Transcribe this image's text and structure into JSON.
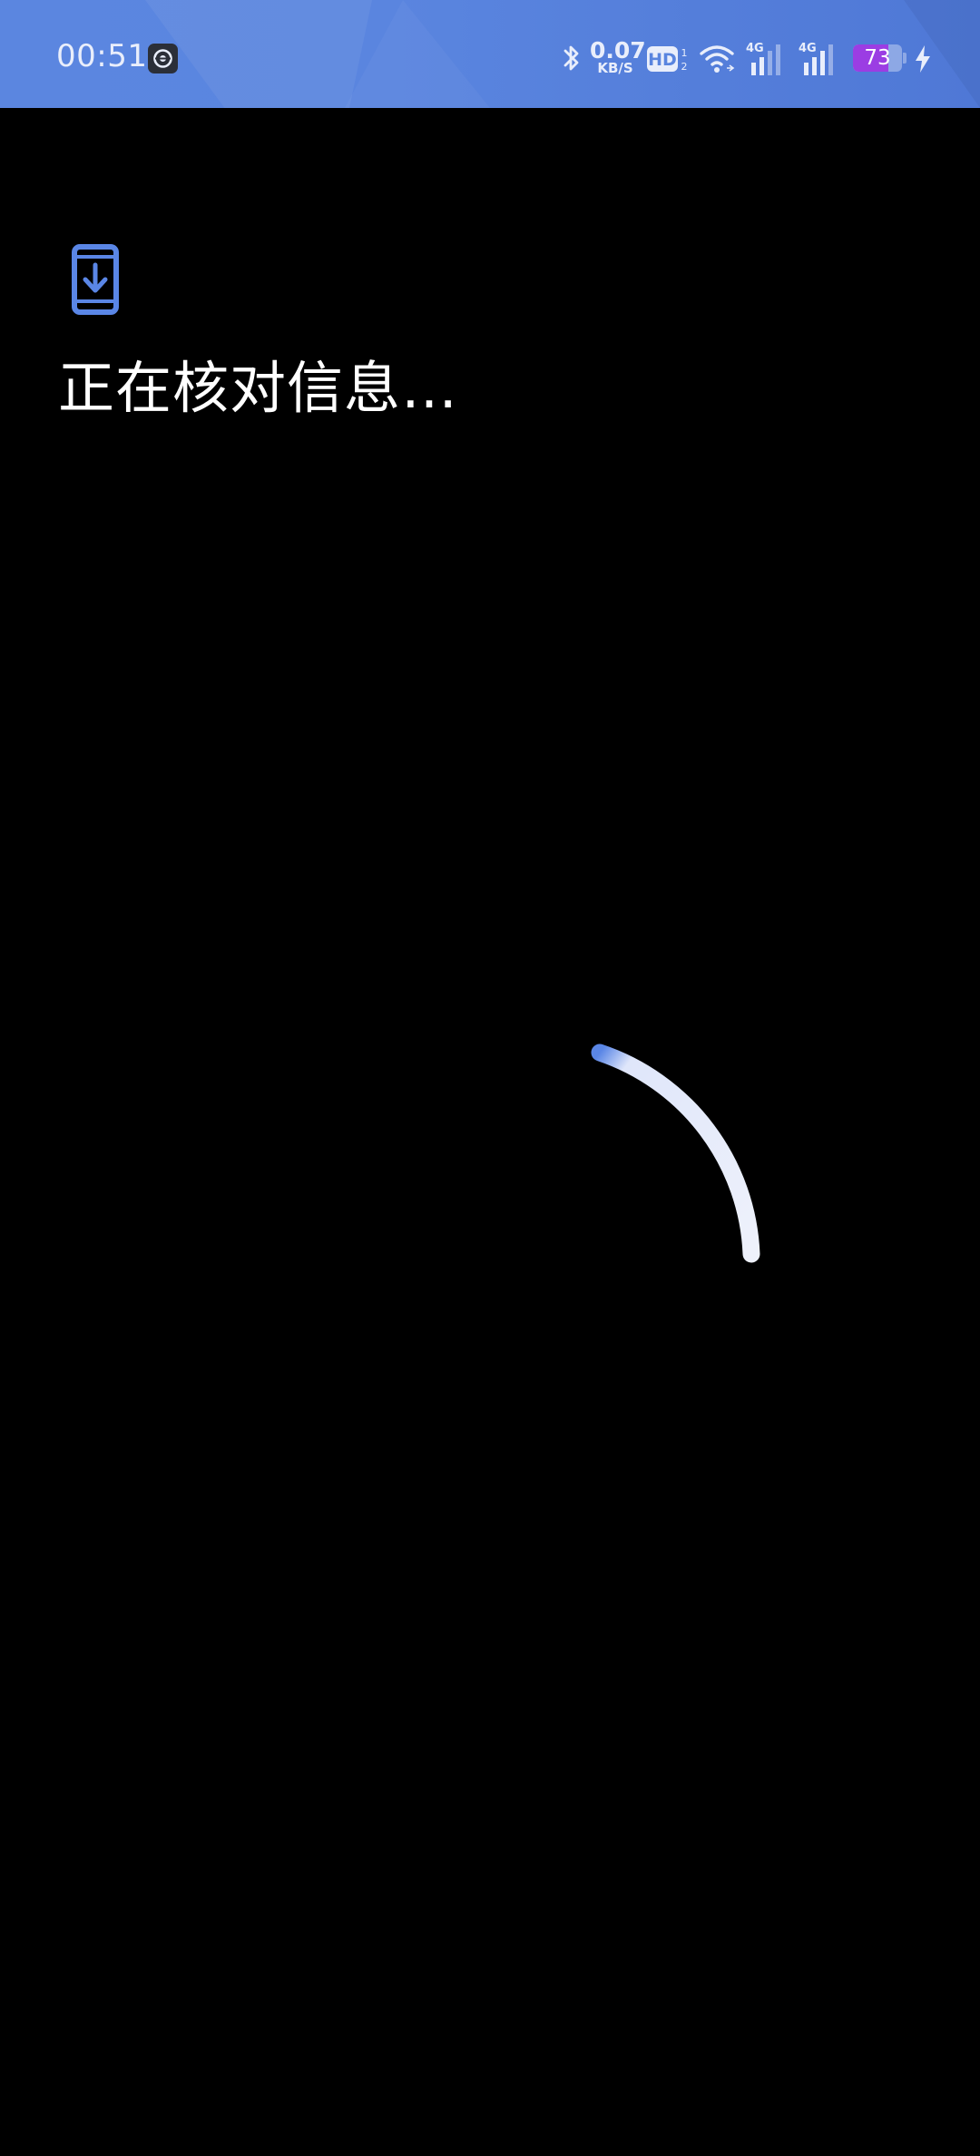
{
  "status_bar": {
    "time": "00:51",
    "app_icon": "camera-shield-icon",
    "bluetooth_icon": "bluetooth-icon",
    "net_speed_value": "0.07",
    "net_speed_unit": "KB/S",
    "hd_icon": "hd-voice-icon",
    "wifi_icon": "wifi-icon",
    "signal_1_icon": "signal-4g-icon",
    "signal_2_icon": "signal-4g-icon",
    "battery_level": "73",
    "battery_fraction": 0.73,
    "battery_color": "#9b3de3",
    "charging_icon": "charging-bolt-icon",
    "bar_color": "#5a85df"
  },
  "main": {
    "header_icon": "phone-download-icon",
    "accent_color": "#5a86e6",
    "title": "正在核对信息…",
    "loading_icon": "loading-spinner-icon"
  }
}
